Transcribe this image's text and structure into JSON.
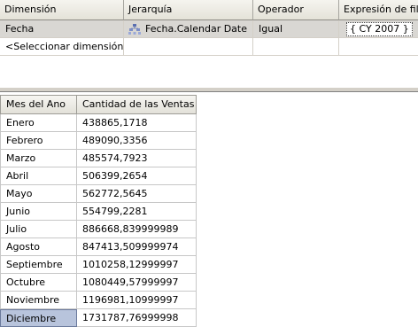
{
  "filter": {
    "headers": {
      "dimension": "Dimensión",
      "hierarchy": "Jerarquía",
      "operator": "Operador",
      "expression": "Expresión de filtro"
    },
    "rows": [
      {
        "dimension": "Fecha",
        "hierarchy": "Fecha.Calendar Date",
        "operator": "Igual",
        "expression": "{ CY 2007 }"
      }
    ],
    "add_row_label": "<Seleccionar dimensión>"
  },
  "results": {
    "headers": {
      "month": "Mes del Ano",
      "sales": "Cantidad de las Ventas ..."
    },
    "rows": [
      {
        "month": "Enero",
        "sales": "438865,1718"
      },
      {
        "month": "Febrero",
        "sales": "489090,3356"
      },
      {
        "month": "Marzo",
        "sales": "485574,7923"
      },
      {
        "month": "Abril",
        "sales": "506399,2654"
      },
      {
        "month": "Mayo",
        "sales": "562772,5645"
      },
      {
        "month": "Junio",
        "sales": "554799,2281"
      },
      {
        "month": "Julio",
        "sales": "886668,839999989"
      },
      {
        "month": "Agosto",
        "sales": "847413,509999974"
      },
      {
        "month": "Septiembre",
        "sales": "1010258,12999997"
      },
      {
        "month": "Octubre",
        "sales": "1080449,57999997"
      },
      {
        "month": "Noviembre",
        "sales": "1196981,10999997"
      },
      {
        "month": "Diciembre",
        "sales": "1731787,76999998"
      }
    ],
    "selected_index": 11
  },
  "colors": {
    "selection": "#b8c4dc",
    "header": "#e4e2d8",
    "filter_row": "#d9d7d3"
  }
}
